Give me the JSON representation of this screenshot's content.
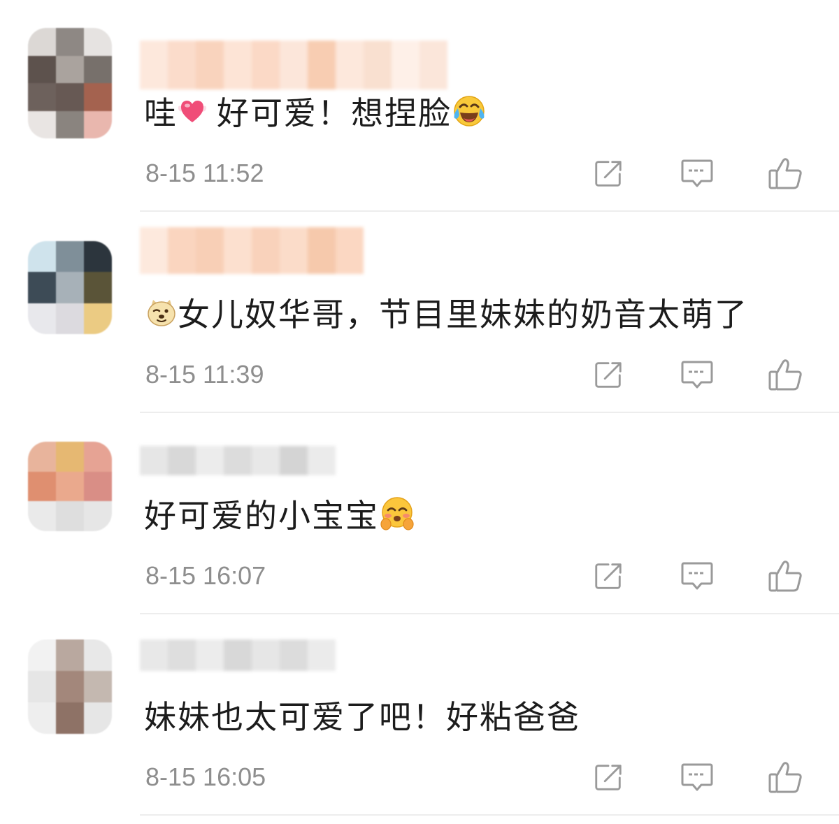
{
  "actions": [
    "share-icon",
    "comment-icon",
    "like-icon"
  ],
  "colors": {
    "text": "#1c1c1c",
    "time": "#8e8e8e",
    "icon": "#9a9a9a",
    "divider": "#ededed"
  },
  "comments": [
    {
      "avatar_tiles": [
        [
          "#dcd8d5",
          "#8e8884",
          "#e6e3e1"
        ],
        [
          "#5d524d",
          "#aaa39e",
          "#77706b"
        ],
        [
          "#6d615c",
          "#675954",
          "#a4624f"
        ],
        [
          "#e9e5e3",
          "#8a847f",
          "#e9b7ae"
        ]
      ],
      "username_blur": [
        "#fde8dc",
        "#fbdccb",
        "#f9d3bd",
        "#fde4d6",
        "#fbd9c6",
        "#fce6da",
        "#f8cdb2",
        "#fde8dc",
        "#f9e0d0",
        "#fef0e8",
        "#fbe6da"
      ],
      "parts": [
        {
          "text": "哇"
        },
        {
          "emoji": "heart-emoji"
        },
        {
          "text": "好可爱！想捏脸"
        },
        {
          "emoji": "laughing-crying-emoji"
        }
      ],
      "time": "8-15 11:52"
    },
    {
      "avatar_tiles": [
        [
          "#cfe3ec",
          "#7f8f99",
          "#2c353d"
        ],
        [
          "#3d4b56",
          "#a7b1b8",
          "#5a5438"
        ],
        [
          "#e8e8ec",
          "#dcdadf",
          "#ebcb83"
        ]
      ],
      "username_blur": [
        "#fde9dd",
        "#fad5bf",
        "#f8cfb6",
        "#fce0cf",
        "#f9d2bb",
        "#fbdcc9",
        "#f6c9ac",
        "#fbd7c2"
      ],
      "parts": [
        {
          "emoji": "doge-emoji"
        },
        {
          "text": "女儿奴华哥，节目里妹妹的奶音太萌了"
        }
      ],
      "time": "8-15 11:39"
    },
    {
      "avatar_tiles": [
        [
          "#e8b49c",
          "#e6b872",
          "#e6a394"
        ],
        [
          "#df8f70",
          "#eaa98d",
          "#d98e86"
        ],
        [
          "#eaeaea",
          "#dedede",
          "#e6e6e6"
        ]
      ],
      "username_blur": [
        "#e6e6e6",
        "#d8d8d8",
        "#ececec",
        "#dcdcdc",
        "#e8e8e8",
        "#d4d4d4",
        "#ebebeb"
      ],
      "parts": [
        {
          "text": "好可爱的小宝宝"
        },
        {
          "emoji": "shy-blush-emoji"
        }
      ],
      "time": "8-15 16:07"
    },
    {
      "avatar_tiles": [
        [
          "#f2f2f2",
          "#b9a89f",
          "#e8e8e8"
        ],
        [
          "#e6e6e6",
          "#a3877b",
          "#c4b8b0"
        ],
        [
          "#eeeeee",
          "#8e7266",
          "#e6e6e6"
        ]
      ],
      "username_blur": [
        "#e8e8e8",
        "#dedede",
        "#ececec",
        "#d8d8d8",
        "#e6e6e6",
        "#dcdcdc",
        "#ebebeb"
      ],
      "parts": [
        {
          "text": "妹妹也太可爱了吧！好粘爸爸"
        }
      ],
      "time": "8-15 16:05"
    }
  ]
}
